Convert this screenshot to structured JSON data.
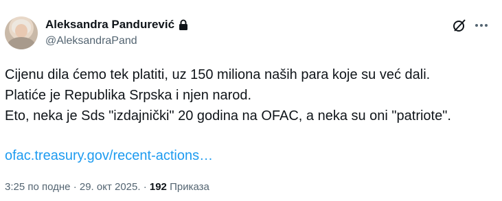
{
  "tweet": {
    "author_name": "Aleksandra Pandurević",
    "handle": "@AleksandraPand",
    "lines": [
      "Cijenu dila ćemo tek platiti, uz 150 miliona naših para koje su već dali.",
      "Platiće je Republika Srpska i njen narod.",
      "Eto, neka je Sds \"izdajnički\" 20 godina na OFAC, a neka su oni \"patriote\"."
    ],
    "link_text": "ofac.treasury.gov/recent-actions…",
    "time": "3:25 по подне",
    "date": "29. окт 2025.",
    "sep": "·",
    "views_count": "192",
    "views_label": "Приказа"
  },
  "icons": {
    "lock": "lock-icon",
    "grok": "grok-icon",
    "more": "more-icon"
  }
}
